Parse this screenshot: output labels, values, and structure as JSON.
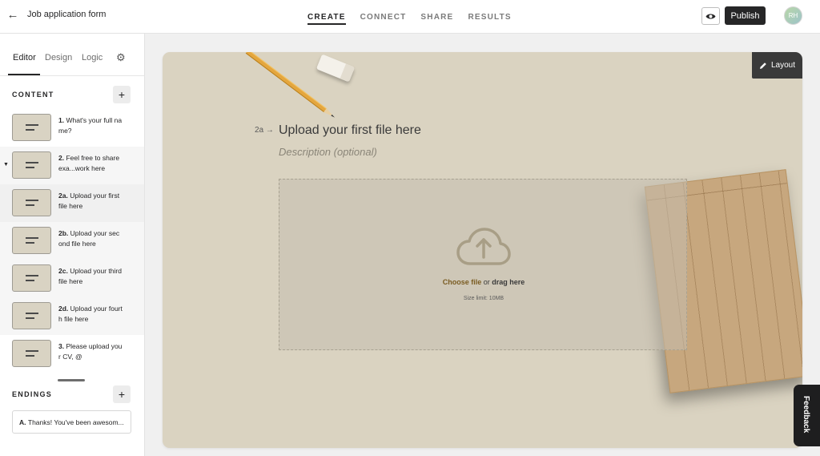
{
  "header": {
    "back_icon": "arrow-left-icon",
    "title": "Job application form",
    "tabs": [
      {
        "label": "CREATE",
        "active": true
      },
      {
        "label": "CONNECT",
        "active": false
      },
      {
        "label": "SHARE",
        "active": false
      },
      {
        "label": "RESULTS",
        "active": false
      }
    ],
    "preview_icon": "eye-icon",
    "publish_label": "Publish",
    "avatar_initials": "RH"
  },
  "sidebar": {
    "tabs": [
      {
        "label": "Editor",
        "active": true
      },
      {
        "label": "Design",
        "active": false
      },
      {
        "label": "Logic",
        "active": false
      }
    ],
    "settings_icon": "gear-icon",
    "content_label": "CONTENT",
    "add_label": "+",
    "questions": [
      {
        "num": "1.",
        "text": "What's your full name?"
      },
      {
        "num": "2.",
        "text": "Feel free to share exa...work here"
      },
      {
        "num": "2a.",
        "text": "Upload your first file here"
      },
      {
        "num": "2b.",
        "text": "Upload your second file here"
      },
      {
        "num": "2c.",
        "text": "Upload your third file here"
      },
      {
        "num": "2d.",
        "text": "Upload your fourth file here"
      },
      {
        "num": "3.",
        "text": "Please upload your CV, @"
      }
    ],
    "endings_label": "ENDINGS",
    "endings": [
      {
        "num": "A.",
        "text": "Thanks! You've been awesom..."
      }
    ]
  },
  "canvas": {
    "layout_label": "Layout",
    "question_ref": "2a",
    "question_title": "Upload your first file here",
    "description_placeholder": "Description (optional)",
    "choose_file": "Choose file",
    "or_text": "or",
    "drag_here": "drag here",
    "size_limit": "Size limit: 10MB",
    "bg_color": "#dad3c1"
  },
  "feedback_label": "Feedback"
}
